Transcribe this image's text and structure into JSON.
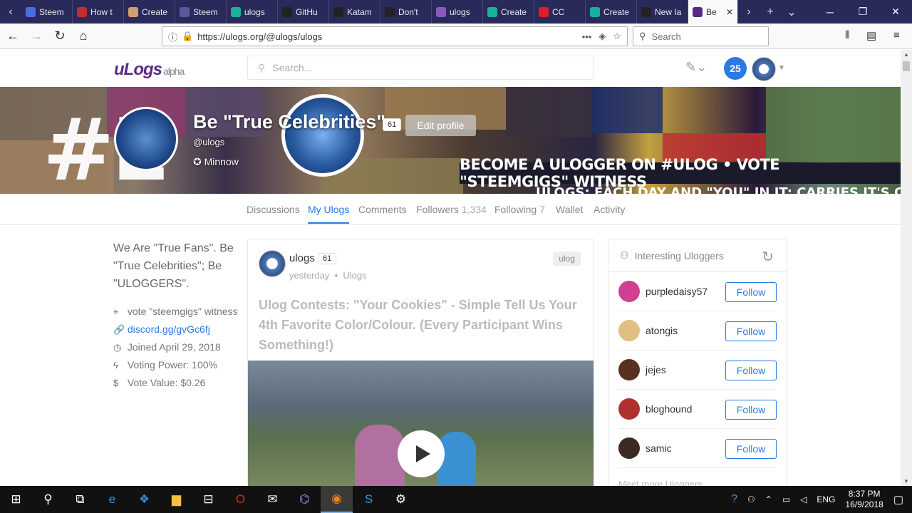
{
  "browser": {
    "tabs": [
      {
        "label": "Steem",
        "color": "#4a6de0"
      },
      {
        "label": "How t",
        "color": "#c0302a"
      },
      {
        "label": "Create",
        "color": "#d0a070"
      },
      {
        "label": "Steem",
        "color": "#5a5a9a"
      },
      {
        "label": "ulogs",
        "color": "#1ab0a0"
      },
      {
        "label": "GitHu",
        "color": "#222222"
      },
      {
        "label": "Katam",
        "color": "#222222"
      },
      {
        "label": "Don't",
        "color": "#222222"
      },
      {
        "label": "ulogs",
        "color": "#8a5ac0"
      },
      {
        "label": "Create",
        "color": "#1ab0a0"
      },
      {
        "label": "CC",
        "color": "#e02020"
      },
      {
        "label": "Create",
        "color": "#1ab0a0"
      },
      {
        "label": "New Ia",
        "color": "#222222"
      }
    ],
    "active_tab": "Be",
    "url": "https://ulogs.org/@ulogs/ulogs",
    "search_placeholder": "Search"
  },
  "site": {
    "logo_text": "uLogs",
    "logo_tag": "alpha",
    "search_placeholder": "Search...",
    "notifications": "25"
  },
  "profile": {
    "name": "Be \"True Celebrities\"",
    "reputation": "61",
    "edit_label": "Edit profile",
    "handle": "@ulogs",
    "rank": "Minnow",
    "slogan": "BECOME A ULOGGER ON #ULOG • VOTE  \"STEEMGIGS\" WITNESS",
    "slogan2": "ULOGS: EACH DAY AND \"YOU\" IN IT: CARRIES IT'S OWN"
  },
  "subnav": [
    {
      "label": "Discussions",
      "count": ""
    },
    {
      "label": "My Ulogs",
      "count": ""
    },
    {
      "label": "Comments",
      "count": ""
    },
    {
      "label": "Followers",
      "count": "1,334"
    },
    {
      "label": "Following",
      "count": "7"
    },
    {
      "label": "Wallet",
      "count": ""
    },
    {
      "label": "Activity",
      "count": ""
    }
  ],
  "sidebar": {
    "about": "We Are \"True Fans\". Be \"True Celebrities\"; Be \"ULOGGERS\".",
    "location": "vote \"steemgigs\" witness",
    "link": "discord.gg/gvGc6fj",
    "joined": "Joined April 29, 2018",
    "voting_power": "Voting Power: 100%",
    "vote_value": "Vote Value: $0.26"
  },
  "post": {
    "author": "ulogs",
    "reputation": "61",
    "time": "yesterday",
    "category": "Ulogs",
    "tag": "ulog",
    "title": "Ulog Contests: \"Your Cookies\" - Simple Tell Us Your 4th Favorite Color/Colour. (Every Participant Wins Something!)"
  },
  "interesting": {
    "title": "Interesting Uloggers",
    "follow_label": "Follow",
    "more": "Meet more Uloggers",
    "users": [
      {
        "name": "purpledaisy57",
        "color": "#d04090"
      },
      {
        "name": "atongis",
        "color": "#e0c080"
      },
      {
        "name": "jejes",
        "color": "#5a3020"
      },
      {
        "name": "bloghound",
        "color": "#b03030"
      },
      {
        "name": "samic",
        "color": "#3a2a20"
      }
    ]
  },
  "taskbar": {
    "time": "8:37 PM",
    "date": "16/9/2018",
    "lang": "ENG"
  }
}
